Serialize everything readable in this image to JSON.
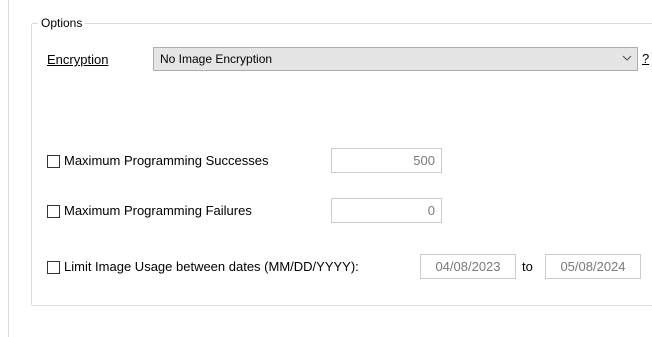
{
  "options_group": {
    "title": "Options"
  },
  "encryption": {
    "label": "Encryption",
    "selected": "No Image Encryption",
    "help_link": "?"
  },
  "max_successes": {
    "label": "Maximum Programming Successes",
    "checked": false,
    "value": "500"
  },
  "max_failures": {
    "label": "Maximum Programming Failures",
    "checked": false,
    "value": "0"
  },
  "date_limit": {
    "label": "Limit Image Usage between dates (MM/DD/YYYY):",
    "checked": false,
    "start": "04/08/2023",
    "to_label": "to",
    "end": "05/08/2024"
  }
}
